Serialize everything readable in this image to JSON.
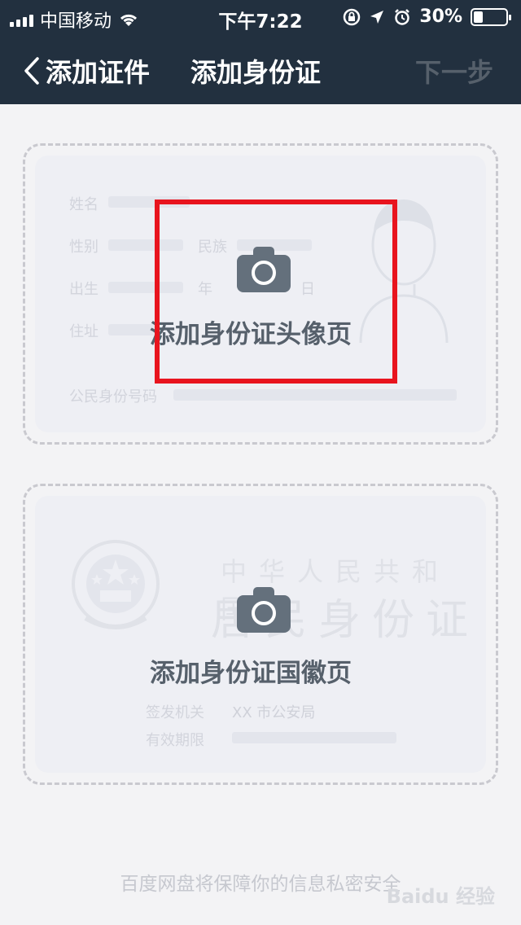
{
  "status": {
    "carrier": "中国移动",
    "time": "下午7:22",
    "battery": "30%",
    "battery_level": 0.3,
    "icons": [
      "signal-icon",
      "wifi-icon",
      "rotation-lock-icon",
      "location-icon",
      "alarm-icon",
      "battery-icon"
    ]
  },
  "nav": {
    "back_label": "添加证件",
    "title": "添加身份证",
    "next_label": "下一步"
  },
  "front_card": {
    "action_label": "添加身份证头像页",
    "fields": {
      "name": "姓名",
      "gender": "性别",
      "ethnicity": "民族",
      "birth": "出生",
      "year": "年",
      "day": "日",
      "address": "住址",
      "id_number": "公民身份号码"
    }
  },
  "back_card": {
    "action_label": "添加身份证国徽页",
    "country": "中华人民共和国",
    "doc_title": "居民身份证",
    "issuer_label": "签发机关",
    "issuer_value": "XX 市公安局",
    "validity_label": "有效期限"
  },
  "footer": {
    "note": "百度网盘将保障你的信息私密安全"
  },
  "watermark": "Baidu 经验"
}
